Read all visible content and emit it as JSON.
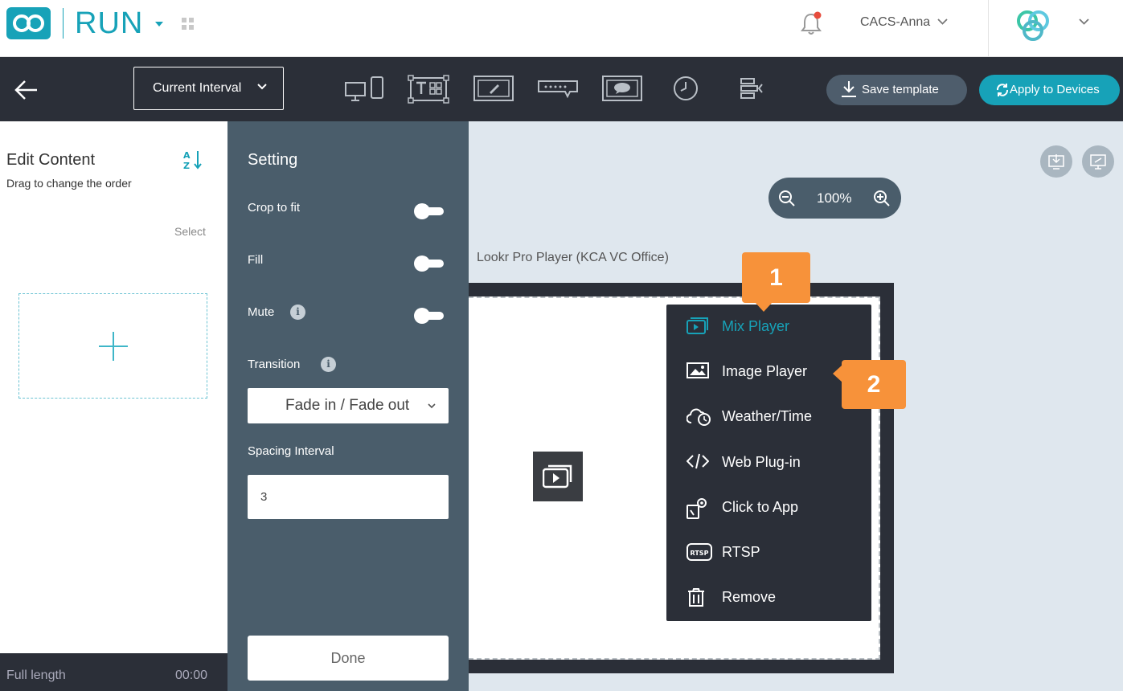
{
  "header": {
    "brand": "RUN",
    "user_name": "CACS-Anna"
  },
  "toolbar": {
    "interval_label": "Current Interval",
    "save_label": "Save template",
    "apply_label": "Apply to Devices",
    "tools": [
      "display-layout-icon",
      "template-text-qr-icon",
      "draw-frame-icon",
      "ticker-icon",
      "message-frame-icon",
      "clock-icon",
      "align-icon"
    ]
  },
  "left_panel": {
    "title": "Edit Content",
    "subtitle": "Drag to change the order",
    "select_label": "Select",
    "footer_label": "Full length",
    "footer_time": "00:00"
  },
  "settings": {
    "title": "Setting",
    "crop_to_fit": {
      "label": "Crop to fit",
      "on": false
    },
    "fill": {
      "label": "Fill",
      "on": false
    },
    "mute": {
      "label": "Mute",
      "on": false
    },
    "transition_label": "Transition",
    "transition_value": "Fade in / Fade out",
    "spacing_label": "Spacing Interval",
    "spacing_value": "3",
    "done_label": "Done",
    "info_glyph": "i"
  },
  "canvas": {
    "zoom_value": "100%",
    "player_name": "Lookr Pro Player (KCA VC Office)"
  },
  "context_menu": {
    "items": [
      {
        "label": "Mix Player",
        "icon": "mix-player-icon",
        "active": true
      },
      {
        "label": "Image Player",
        "icon": "image-player-icon",
        "active": false
      },
      {
        "label": "Weather/Time",
        "icon": "weather-time-icon",
        "active": false
      },
      {
        "label": "Web Plug-in",
        "icon": "code-icon",
        "active": false
      },
      {
        "label": "Click to App",
        "icon": "click-to-app-icon",
        "active": false
      },
      {
        "label": "RTSP",
        "icon": "rtsp-icon",
        "active": false
      },
      {
        "label": "Remove",
        "icon": "trash-icon",
        "active": false
      }
    ]
  },
  "callouts": [
    "1",
    "2"
  ],
  "colors": {
    "accent": "#17a2b8",
    "dark": "#2b2f38",
    "panel": "#4a5d6b",
    "callout": "#f7923a",
    "canvas_bg": "#dfe7ee"
  }
}
